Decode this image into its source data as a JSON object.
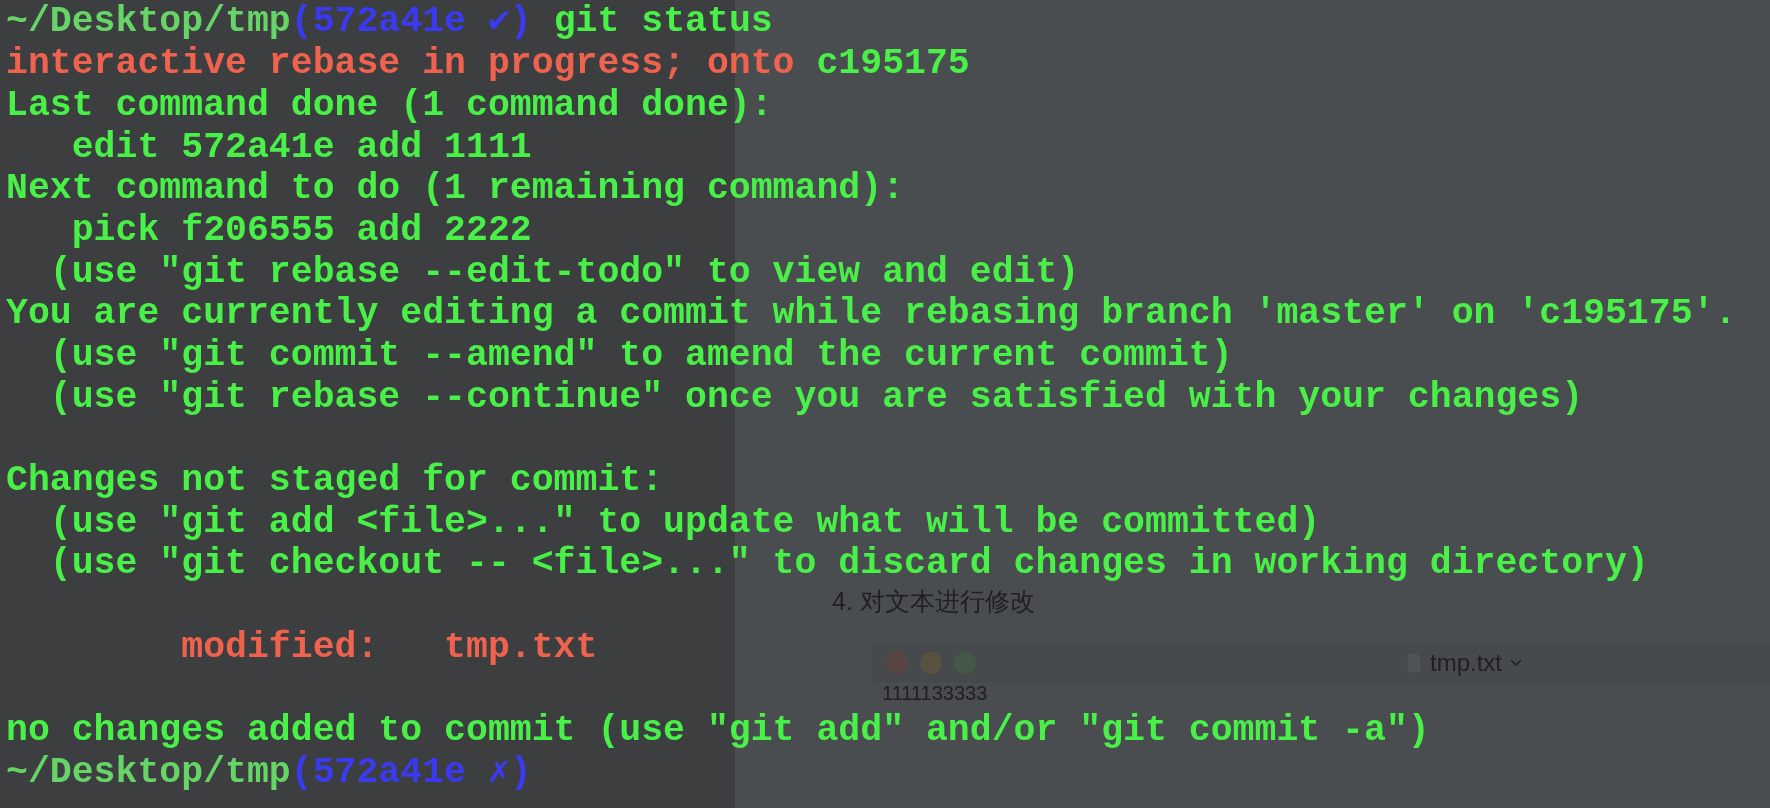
{
  "backdrop": {
    "heading": "4. 对文本进行修改",
    "editor": {
      "file": "tmp.txt",
      "content": "1111133333"
    }
  },
  "terminal": {
    "lines": [
      {
        "kind": "text",
        "segments": [
          {
            "kind": "path",
            "text": "~/Desktop/tmp"
          },
          {
            "kind": "branch",
            "text": "(572a41e ✔)"
          },
          {
            "kind": "plain",
            "text": " git status"
          }
        ]
      },
      {
        "kind": "text",
        "segments": [
          {
            "kind": "warning",
            "text": "interactive rebase in progress; onto "
          },
          {
            "kind": "plain",
            "text": "c195175"
          }
        ]
      },
      {
        "kind": "text",
        "segments": [
          {
            "kind": "plain",
            "text": "Last command done (1 command done):"
          }
        ]
      },
      {
        "kind": "text",
        "segments": [
          {
            "kind": "plain",
            "text": "   edit 572a41e add 1111"
          }
        ]
      },
      {
        "kind": "text",
        "segments": [
          {
            "kind": "plain",
            "text": "Next command to do (1 remaining command):"
          }
        ]
      },
      {
        "kind": "text",
        "segments": [
          {
            "kind": "plain",
            "text": "   pick f206555 add 2222"
          }
        ]
      },
      {
        "kind": "text",
        "segments": [
          {
            "kind": "plain",
            "text": "  (use \"git rebase --edit-todo\" to view and edit)"
          }
        ]
      },
      {
        "kind": "text",
        "segments": [
          {
            "kind": "plain",
            "text": "You are currently editing a commit while rebasing branch 'master' on 'c195175'."
          }
        ]
      },
      {
        "kind": "text",
        "segments": [
          {
            "kind": "plain",
            "text": "  (use \"git commit --amend\" to amend the current commit)"
          }
        ]
      },
      {
        "kind": "text",
        "segments": [
          {
            "kind": "plain",
            "text": "  (use \"git rebase --continue\" once you are satisfied with your changes)"
          }
        ]
      },
      {
        "kind": "blank"
      },
      {
        "kind": "text",
        "segments": [
          {
            "kind": "plain",
            "text": "Changes not staged for commit:"
          }
        ]
      },
      {
        "kind": "text",
        "segments": [
          {
            "kind": "plain",
            "text": "  (use \"git add <file>...\" to update what will be committed)"
          }
        ]
      },
      {
        "kind": "text",
        "segments": [
          {
            "kind": "plain",
            "text": "  (use \"git checkout -- <file>...\" to discard changes in working directory)"
          }
        ]
      },
      {
        "kind": "blank"
      },
      {
        "kind": "text",
        "segments": [
          {
            "kind": "warning",
            "text": "        modified:   tmp.txt"
          }
        ]
      },
      {
        "kind": "blank"
      },
      {
        "kind": "text",
        "segments": [
          {
            "kind": "plain",
            "text": "no changes added to commit (use \"git add\" and/or \"git commit -a\")"
          }
        ]
      },
      {
        "kind": "text",
        "segments": [
          {
            "kind": "path",
            "text": "~/Desktop/tmp"
          },
          {
            "kind": "branch",
            "text": "(572a41e ✗)"
          }
        ]
      }
    ]
  }
}
